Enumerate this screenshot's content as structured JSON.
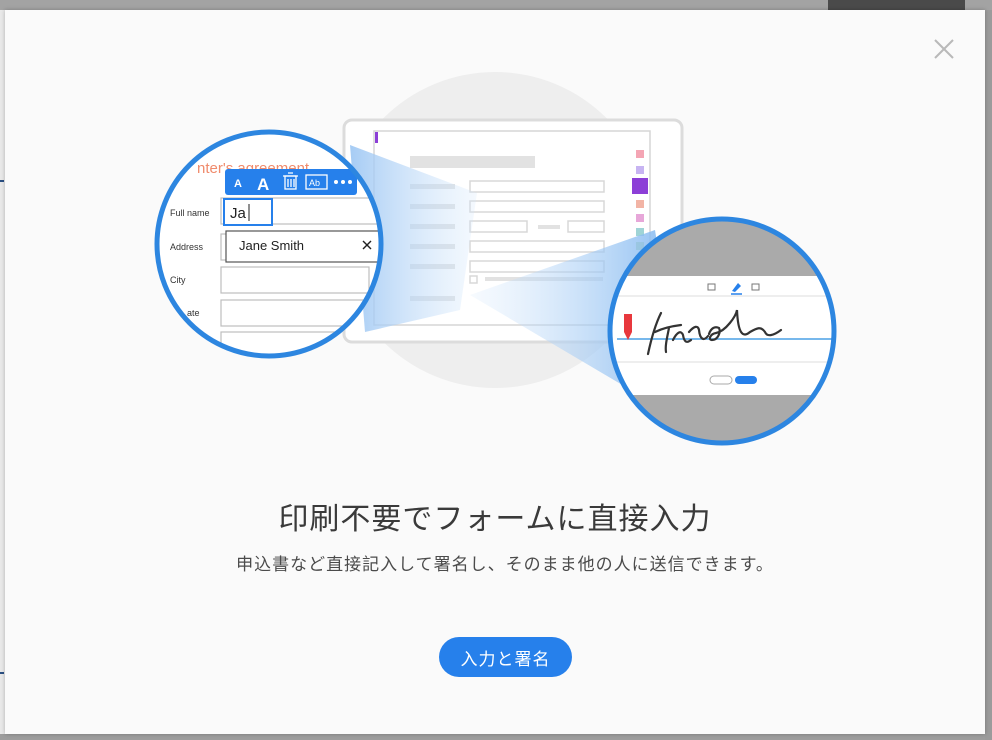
{
  "dialog": {
    "close_icon": "close-icon",
    "headline": "印刷不要でフォームに直接入力",
    "description": "申込書など直接記入して署名し、そのまま他の人に送信できます。",
    "cta_label": "入力と署名"
  },
  "illustration": {
    "form_title": "nter's agreement",
    "toolbar": {
      "small_a": "A",
      "large_a": "A",
      "delete_icon": "trash-icon",
      "text_field_icon": "Ab",
      "more_icon": "more-icon"
    },
    "fields": {
      "full_name_label": "Full name",
      "full_name_value": "Ja",
      "address_label": "Address",
      "city_label": "City",
      "state_label": "ate"
    },
    "autocomplete": {
      "suggestion": "Jane Smith",
      "dismiss_icon": "close-icon"
    },
    "signature": {
      "signature_text": "Finder",
      "pen_icon": "pen-icon"
    }
  },
  "colors": {
    "accent": "#2680eb",
    "circle_border": "#2d86e0",
    "purple_marker": "#8c3fd7",
    "agreement_text": "#f08b6c"
  }
}
